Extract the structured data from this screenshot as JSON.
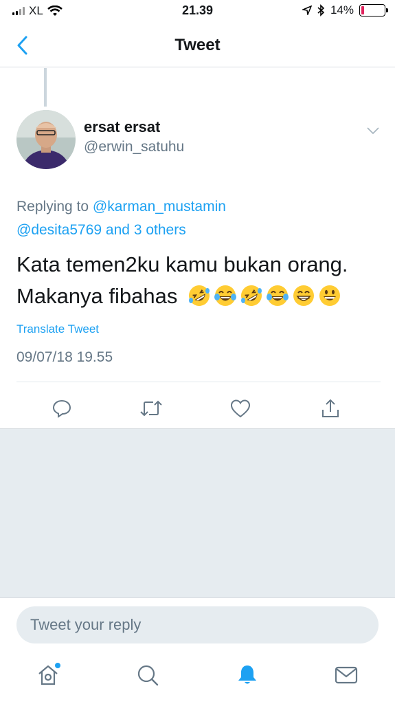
{
  "status_bar": {
    "carrier": "XL",
    "time": "21.39",
    "battery": "14%",
    "battery_level": 0.14
  },
  "nav": {
    "title": "Tweet"
  },
  "tweet": {
    "display_name": "ersat ersat",
    "handle": "@erwin_satuhu",
    "replying_prefix": "Replying to",
    "replying_mention": "@karman_mustamin",
    "replying_mention2": "@desita5769",
    "replying_and": "and",
    "replying_others": "3 others",
    "text_line1": "Kata temen2ku kamu bukan orang.",
    "text_line2": "Makanya fibahas",
    "emojis": [
      "🤣",
      "😂",
      "🤣",
      "😂",
      "😁",
      "😀"
    ],
    "translate_label": "Translate Tweet",
    "timestamp": "09/07/18 19.55"
  },
  "reply": {
    "placeholder": "Tweet your reply"
  },
  "colors": {
    "accent": "#1da1f2",
    "secondary_text": "#657786",
    "background_gray": "#e6ecf0",
    "battery_low": "#e0245e"
  }
}
